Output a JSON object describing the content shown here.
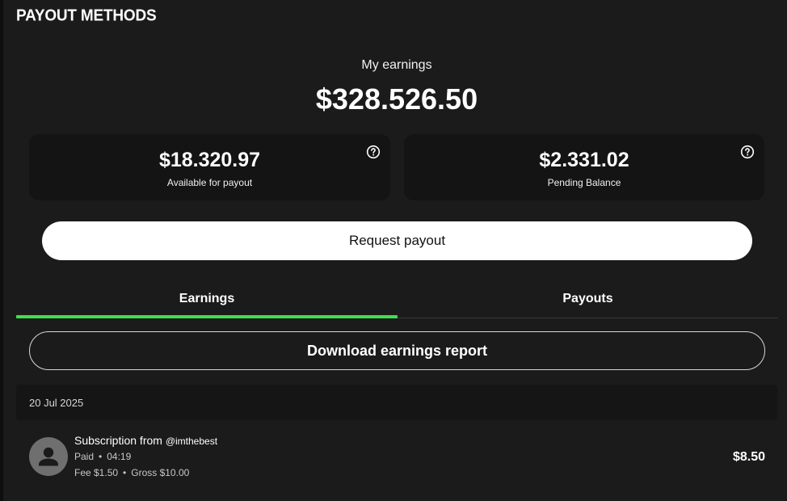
{
  "page": {
    "title": "PAYOUT METHODS"
  },
  "summary": {
    "label": "My earnings",
    "total": "$328.526.50"
  },
  "cards": {
    "available": {
      "amount": "$18.320.97",
      "caption": "Available for payout"
    },
    "pending": {
      "amount": "$2.331.02",
      "caption": "Pending Balance"
    }
  },
  "actions": {
    "request_payout": "Request payout",
    "download_report": "Download earnings report"
  },
  "tabs": [
    {
      "label": "Earnings",
      "active": true
    },
    {
      "label": "Payouts",
      "active": false
    }
  ],
  "transactions": {
    "date": "20 Jul 2025",
    "items": [
      {
        "title": "Subscription from",
        "handle": "@imthebest",
        "status": "Paid",
        "time": "04:19",
        "fee": "Fee $1.50",
        "gross": "Gross $10.00",
        "amount": "$8.50"
      }
    ]
  },
  "colors": {
    "background": "#1b1b1b",
    "card": "#141414",
    "accent": "#3ee04f"
  },
  "icons": {
    "help": "question-circle-icon",
    "avatar": "default-user-avatar-icon"
  }
}
